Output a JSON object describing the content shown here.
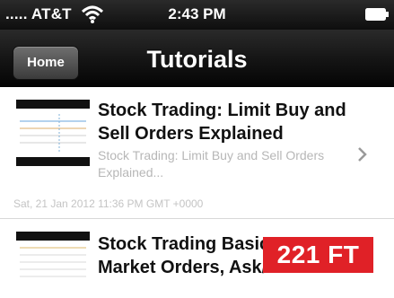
{
  "status_bar": {
    "carrier": "..... AT&T",
    "time": "2:43 PM"
  },
  "nav_bar": {
    "home_button": "Home",
    "title": "Tutorials"
  },
  "items": [
    {
      "title": "Stock Trading: Limit Buy and Sell Orders Explained",
      "subtitle": "Stock Trading: Limit Buy and Sell Orders Explained...",
      "date": "Sat, 21 Jan 2012 11:36 PM GMT +0000"
    },
    {
      "title": "Stock Trading Basic Market Orders, Ask/Bid"
    }
  ],
  "overlay_badge": "221 FT",
  "colors": {
    "badge": "#e02127",
    "bar": "#111111"
  }
}
